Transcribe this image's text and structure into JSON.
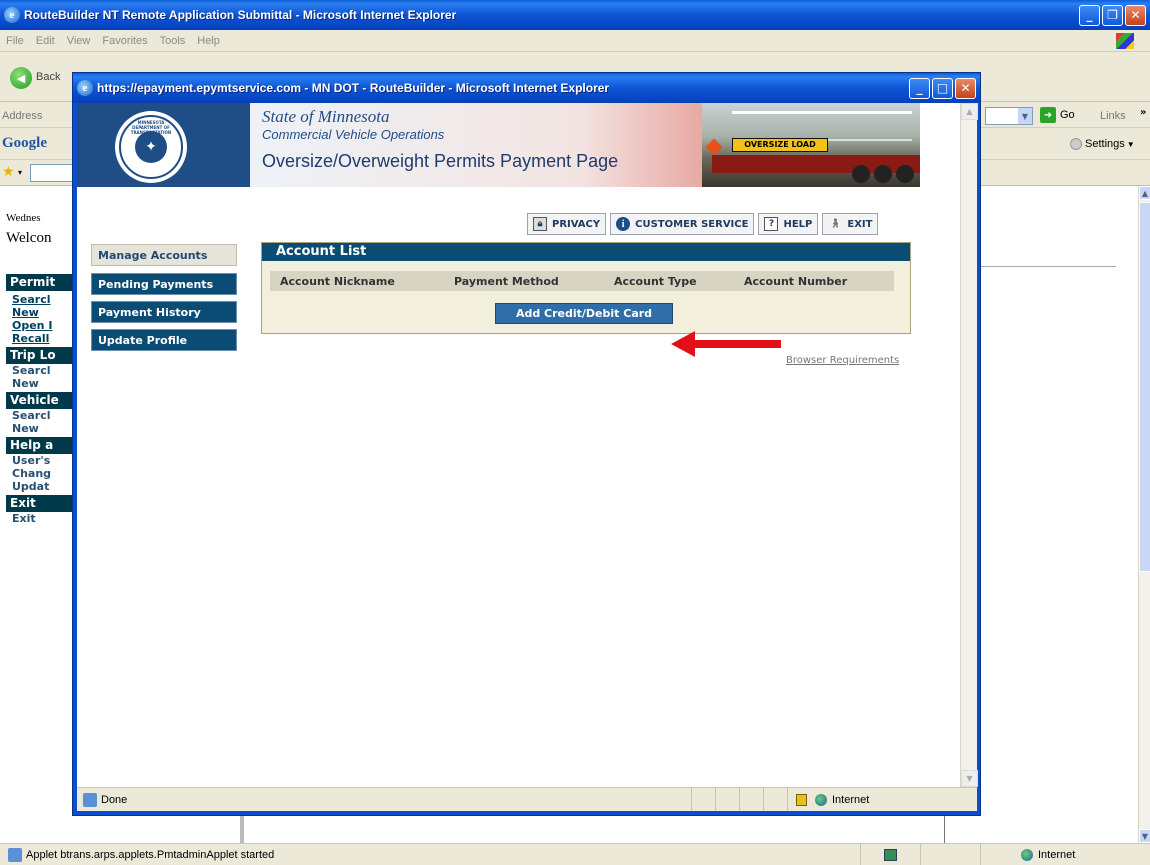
{
  "outer_window": {
    "title": "RouteBuilder NT Remote Application Submittal - Microsoft Internet Explorer",
    "menu": [
      "File",
      "Edit",
      "View",
      "Favorites",
      "Tools",
      "Help"
    ],
    "back_label": "Back",
    "address_label": "Address",
    "go_label": "Go",
    "links_label": "Links",
    "google_label": "Google",
    "settings_label": "Settings",
    "date_partial": "Wednes",
    "welcome_partial": "Welcon",
    "status_text": "Applet btrans.arps.applets.PmtadminApplet started",
    "status_zone": "Internet"
  },
  "sidebar": {
    "sections": [
      {
        "heading": "Permit",
        "links": [
          "Searcl",
          "New",
          "Open I",
          "Recall"
        ]
      },
      {
        "heading": "Trip Lo",
        "links": [
          "Searcl",
          "New"
        ]
      },
      {
        "heading": "Vehicle",
        "links": [
          "Searcl",
          "New"
        ]
      },
      {
        "heading": "Help a",
        "links": [
          "User's",
          "Chang",
          "Updat"
        ]
      },
      {
        "heading": "Exit",
        "links": [
          "Exit"
        ]
      }
    ]
  },
  "popup": {
    "title": "https://epayment.epymtservice.com - MN DOT - RouteBuilder - Microsoft Internet Explorer",
    "banner_line1": "State of Minnesota",
    "banner_line2": "Commercial Vehicle Operations",
    "banner_line3": "Oversize/Overweight Permits Payment Page",
    "seal_text": "MINNESOTA DEPARTMENT OF TRANSPORTATION",
    "truck_sign": "OVERSIZE LOAD",
    "topnav": {
      "privacy": "PRIVACY",
      "customer_service": "CUSTOMER SERVICE",
      "help": "HELP",
      "exit": "EXIT"
    },
    "nav": [
      "Manage Accounts",
      "Pending Payments",
      "Payment History",
      "Update Profile"
    ],
    "account_list": {
      "title": "Account List",
      "columns": [
        "Account Nickname",
        "Payment Method",
        "Account Type",
        "Account Number"
      ],
      "add_button": "Add Credit/Debit Card"
    },
    "browser_requirements": "Browser Requirements",
    "status_text": "Done",
    "status_zone": "Internet"
  },
  "colors": {
    "xp_blue": "#0a5fd8",
    "nav_teal": "#0a4c74",
    "arrow_red": "#e3101a"
  }
}
